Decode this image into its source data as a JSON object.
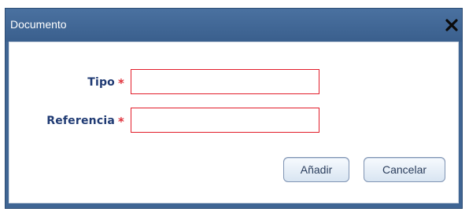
{
  "dialog": {
    "title": "Documento",
    "fields": [
      {
        "label": "Tipo",
        "required_mark": "*",
        "value": ""
      },
      {
        "label": "Referencia",
        "required_mark": "*",
        "value": ""
      }
    ],
    "buttons": {
      "add": "Añadir",
      "cancel": "Cancelar"
    }
  },
  "icons": {
    "close": "close-icon"
  },
  "colors": {
    "titlebar": "#3f6593",
    "label": "#1f3a73",
    "required": "#e0303a",
    "field_border": "#e21d2a"
  }
}
